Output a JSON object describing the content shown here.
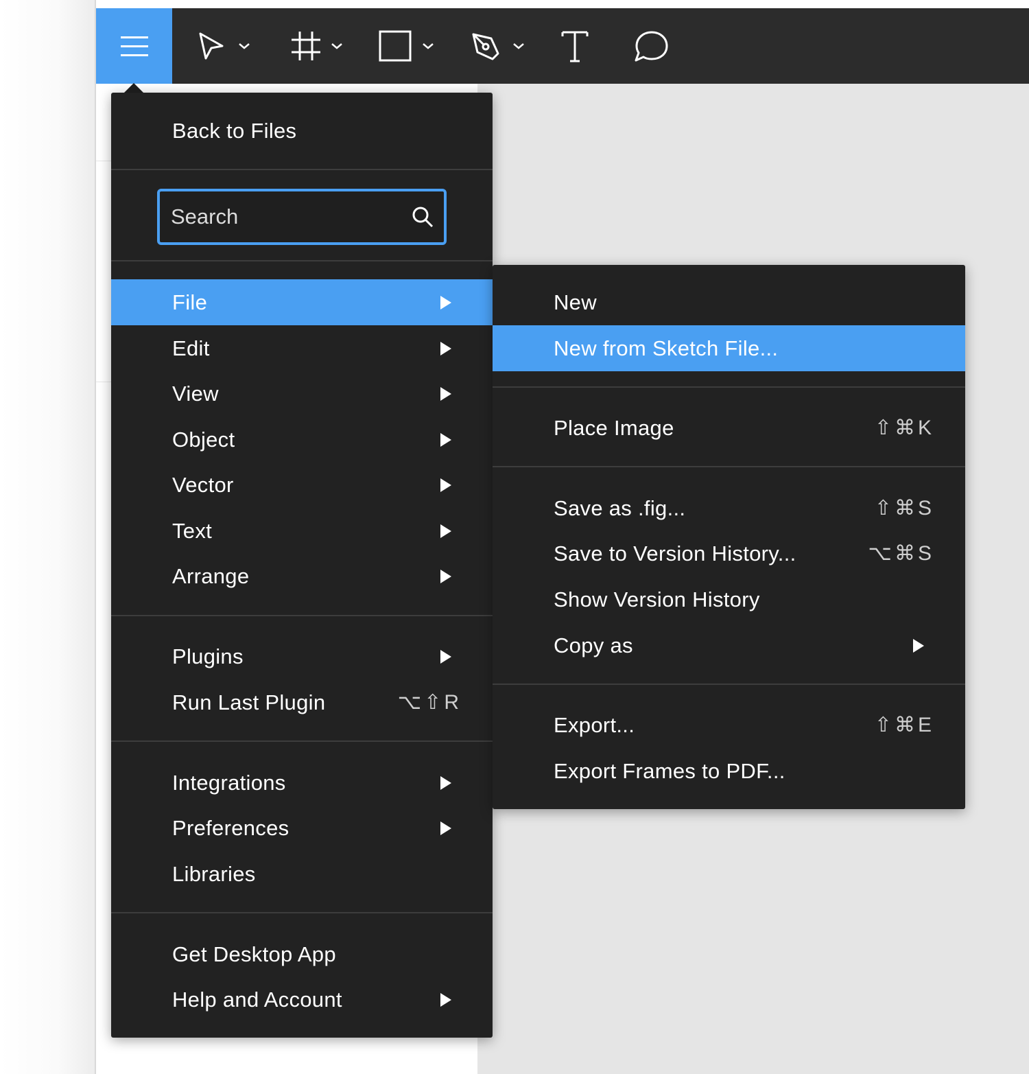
{
  "toolbar": {
    "tools": [
      {
        "name": "move-tool",
        "icon": "cursor-arrow-icon",
        "has_dropdown": true
      },
      {
        "name": "frame-tool",
        "icon": "frame-hash-icon",
        "has_dropdown": true
      },
      {
        "name": "shape-tool",
        "icon": "rectangle-icon",
        "has_dropdown": true
      },
      {
        "name": "pen-tool",
        "icon": "pen-icon",
        "has_dropdown": true
      },
      {
        "name": "text-tool",
        "icon": "text-icon",
        "has_dropdown": false
      },
      {
        "name": "comment-tool",
        "icon": "speech-bubble-icon",
        "has_dropdown": false
      }
    ],
    "accent_color": "#4a9ff2"
  },
  "menu": {
    "back_to_files": "Back to Files",
    "search": {
      "placeholder": "Search",
      "value": ""
    },
    "items": [
      {
        "label": "File",
        "submenu": true,
        "active": true
      },
      {
        "label": "Edit",
        "submenu": true
      },
      {
        "label": "View",
        "submenu": true
      },
      {
        "label": "Object",
        "submenu": true
      },
      {
        "label": "Vector",
        "submenu": true
      },
      {
        "label": "Text",
        "submenu": true
      },
      {
        "label": "Arrange",
        "submenu": true
      },
      {
        "label": "Plugins",
        "submenu": true
      },
      {
        "label": "Run Last Plugin",
        "shortcut": "⌥⇧R"
      },
      {
        "label": "Integrations",
        "submenu": true
      },
      {
        "label": "Preferences",
        "submenu": true
      },
      {
        "label": "Libraries"
      },
      {
        "label": "Get Desktop App"
      },
      {
        "label": "Help and Account",
        "submenu": true
      }
    ]
  },
  "file_submenu": {
    "items": [
      {
        "label": "New"
      },
      {
        "label": "New from Sketch File...",
        "active": true
      },
      {
        "label": "Place Image",
        "shortcut": "⇧⌘K"
      },
      {
        "label": "Save as .fig...",
        "shortcut": "⇧⌘S"
      },
      {
        "label": "Save to Version History...",
        "shortcut": "⌥⌘S"
      },
      {
        "label": "Show Version History"
      },
      {
        "label": "Copy as",
        "submenu": true
      },
      {
        "label": "Export...",
        "shortcut": "⇧⌘E"
      },
      {
        "label": "Export Frames to PDF..."
      }
    ]
  }
}
